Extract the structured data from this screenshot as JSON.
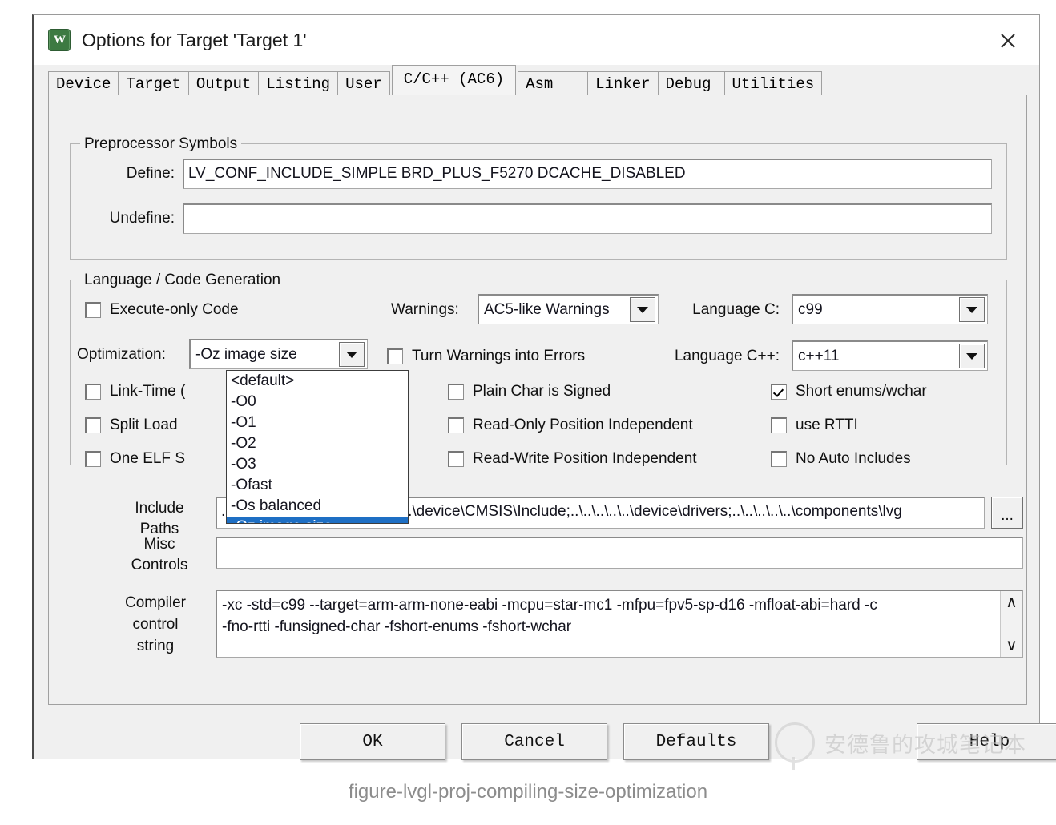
{
  "window": {
    "title": "Options for Target 'Target 1'",
    "icon": "keil-uvision-icon",
    "close_label": "×"
  },
  "tabs": [
    {
      "label": "Device",
      "selected": false
    },
    {
      "label": "Target",
      "selected": false
    },
    {
      "label": "Output",
      "selected": false
    },
    {
      "label": "Listing",
      "selected": false
    },
    {
      "label": "User",
      "selected": false
    },
    {
      "label": "C/C++ (AC6)",
      "selected": true
    },
    {
      "label": "Asm",
      "selected": false
    },
    {
      "label": "Linker",
      "selected": false
    },
    {
      "label": "Debug",
      "selected": false
    },
    {
      "label": "Utilities",
      "selected": false
    }
  ],
  "preprocessor": {
    "legend": "Preprocessor Symbols",
    "define_label": "Define:",
    "define_value": "LV_CONF_INCLUDE_SIMPLE BRD_PLUS_F5270 DCACHE_DISABLED",
    "undefine_label": "Undefine:",
    "undefine_value": ""
  },
  "language": {
    "legend": "Language / Code Generation",
    "execute_only": {
      "label": "Execute-only Code",
      "checked": false
    },
    "optimization_label": "Optimization:",
    "optimization_value": "-Oz image size",
    "link_time": {
      "label": "Link-Time (",
      "checked": false
    },
    "split_load": {
      "label": "Split Load ",
      "checked": false
    },
    "one_elf": {
      "label": "One ELF S",
      "checked": false
    },
    "warnings_label": "Warnings:",
    "warnings_value": "AC5-like Warnings",
    "turn_warnings": {
      "label": "Turn Warnings into Errors",
      "checked": false
    },
    "plain_char": {
      "label": "Plain Char is Signed",
      "checked": false
    },
    "ro_position": {
      "label": "Read-Only Position Independent",
      "checked": false
    },
    "rw_position": {
      "label": "Read-Write Position Independent",
      "checked": false
    },
    "language_c_label": "Language C:",
    "language_c_value": "c99",
    "language_cpp_label": "Language C++:",
    "language_cpp_value": "c++11",
    "short_enums": {
      "label": "Short enums/wchar",
      "checked": true
    },
    "use_rtti": {
      "label": "use RTTI",
      "checked": false
    },
    "no_auto_includes": {
      "label": "No Auto Includes",
      "checked": false
    }
  },
  "optimization_dropdown": {
    "open": true,
    "selected_index": 7,
    "highlight_color": "#1e6fc4",
    "options": [
      "<default>",
      "-O0",
      "-O1",
      "-O2",
      "-O3",
      "-Ofast",
      "-Os balanced",
      "-Oz image size"
    ]
  },
  "include_paths": {
    "label_line1": "Include",
    "label_line2": "Paths",
    "value_prefix": "..",
    "value_visible": "\\..\\device\\CMSIS\\Include;..\\..\\..\\..\\..\\device\\drivers;..\\..\\..\\..\\..\\components\\lvg",
    "browse_label": "..."
  },
  "misc_controls": {
    "label_line1": "Misc",
    "label_line2": "Controls",
    "value": ""
  },
  "compiler_control": {
    "label_line1": "Compiler",
    "label_line2": "control",
    "label_line3": "string",
    "line1": "-xc -std=c99 --target=arm-arm-none-eabi -mcpu=star-mc1 -mfpu=fpv5-sp-d16 -mfloat-abi=hard -c",
    "line2": "-fno-rtti -funsigned-char -fshort-enums -fshort-wchar",
    "scroll_up": "∧",
    "scroll_down": "∨"
  },
  "buttons": {
    "ok": "OK",
    "cancel": "Cancel",
    "defaults": "Defaults",
    "help": "Help"
  },
  "watermark": {
    "text": "安德鲁的攻城笔记本"
  },
  "caption": "figure-lvgl-proj-compiling-size-optimization"
}
